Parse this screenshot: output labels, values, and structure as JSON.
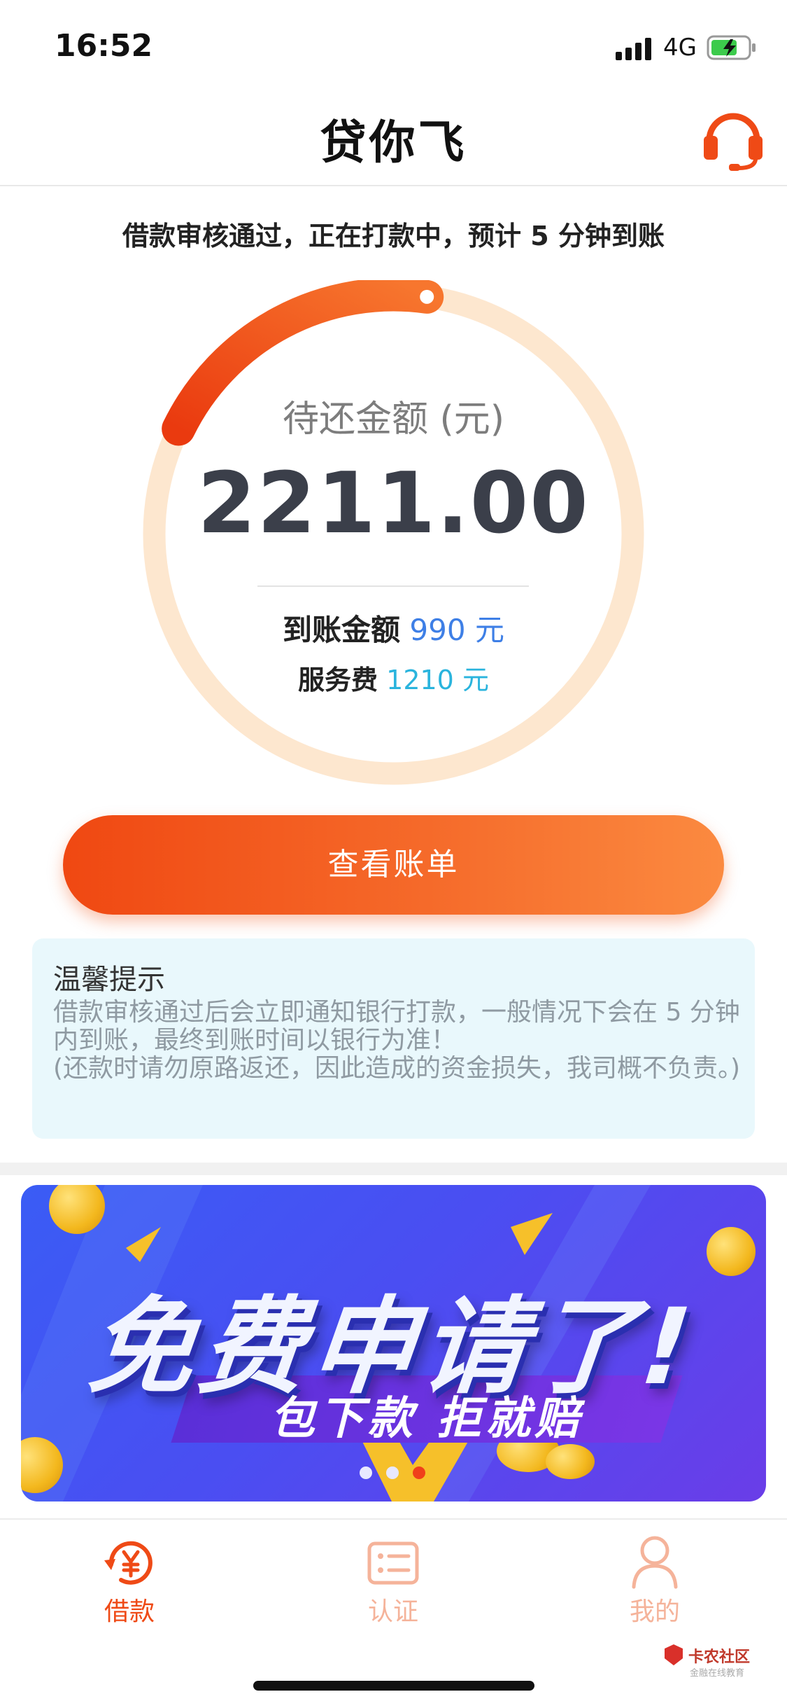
{
  "status_bar": {
    "time": "16:52",
    "network": "4G"
  },
  "header": {
    "title": "贷你飞",
    "support_icon": "headset-icon"
  },
  "notice": "借款审核通过，正在打款中，预计 5 分钟到账",
  "loan_card": {
    "label": "待还金额 (元)",
    "amount": "2211.00",
    "arrival_label": "到账金额",
    "arrival_value": "990 元",
    "fee_label": "服务费",
    "fee_value": "1210 元",
    "progress_fraction": 0.2
  },
  "actions": {
    "view_bill": "查看账单"
  },
  "tips": {
    "title": "温馨提示",
    "line1": "借款审核通过后会立即通知银行打款，一般情况下会在 5 分钟内到账，最终到账时间以银行为准！",
    "line2": "(还款时请勿原路返还，因此造成的资金损失，我司概不负责。)"
  },
  "banner": {
    "title": "免费申请了!",
    "subtitle": "包下款  拒就赔",
    "active_slide": 3,
    "slide_count": 3
  },
  "tabbar": {
    "items": [
      {
        "label": "借款",
        "icon": "yen-refresh-icon",
        "active": true
      },
      {
        "label": "认证",
        "icon": "id-card-icon",
        "active": false
      },
      {
        "label": "我的",
        "icon": "user-icon",
        "active": false
      }
    ]
  },
  "watermark": {
    "text": "卡农社区",
    "sub": "金融在线教育"
  },
  "colors": {
    "accent": "#f04f16",
    "ring_track": "#fde7cf",
    "tab_inactive": "#f5b39a",
    "arrival_blue": "#3e7fe6",
    "fee_cyan": "#2ab4dd"
  }
}
